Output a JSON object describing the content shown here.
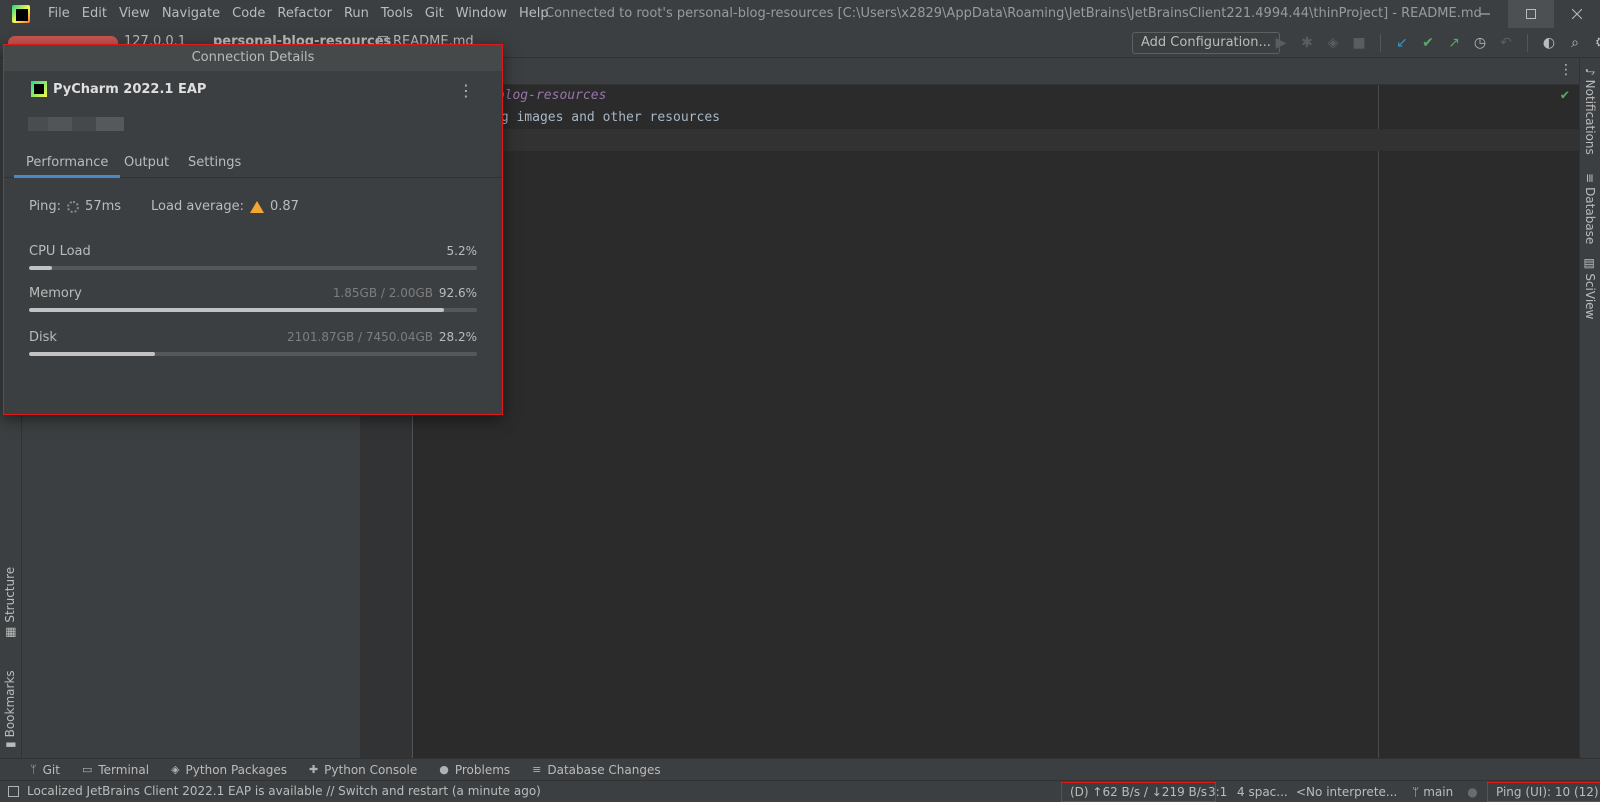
{
  "titlebar": {
    "menu": [
      "File",
      "Edit",
      "View",
      "Navigate",
      "Code",
      "Refactor",
      "Run",
      "Tools",
      "Git",
      "Window",
      "Help"
    ],
    "window_title": "Connected to root's personal-blog-resources [C:\\Users\\x2829\\AppData\\Roaming\\JetBrains\\JetBrainsClient221.4994.44\\thinProject] - README.md"
  },
  "navbar": {
    "host": "127.0.0.1",
    "project": "personal-blog-resources",
    "file": "README.md",
    "add_configuration": "Add Configuration..."
  },
  "editor": {
    "line1": "-blog-resources",
    "line2": "og images and other resources"
  },
  "left_strip": {
    "structure": "Structure",
    "bookmarks": "Bookmarks"
  },
  "right_strip": {
    "notifications": "Notifications",
    "database": "Database",
    "sciview": "SciView"
  },
  "bottom_tools": [
    "Git",
    "Terminal",
    "Python Packages",
    "Python Console",
    "Problems",
    "Database Changes"
  ],
  "statusbar": {
    "message": "Localized JetBrains Client 2022.1 EAP is available // Switch and restart (a minute ago)",
    "traffic": "(D) ↑62 B/s / ↓219 B/s",
    "position": "3:1",
    "indent": "4 spac...",
    "interpreter": "<No interprete...",
    "branch": "main",
    "ping": "Ping (UI): 10 (12)"
  },
  "popup": {
    "title": "Connection Details",
    "app_name": "PyCharm 2022.1 EAP",
    "tabs": [
      "Performance",
      "Output",
      "Settings"
    ],
    "ping_label": "Ping:",
    "ping_value": "57ms",
    "load_label": "Load average:",
    "load_value": "0.87",
    "metrics": [
      {
        "label": "CPU Load",
        "detail": "",
        "percent": "5.2%",
        "fraction": 0.052
      },
      {
        "label": "Memory",
        "detail": "1.85GB / 2.00GB",
        "percent": "92.6%",
        "fraction": 0.926
      },
      {
        "label": "Disk",
        "detail": "2101.87GB / 7450.04GB",
        "percent": "28.2%",
        "fraction": 0.282
      }
    ]
  }
}
